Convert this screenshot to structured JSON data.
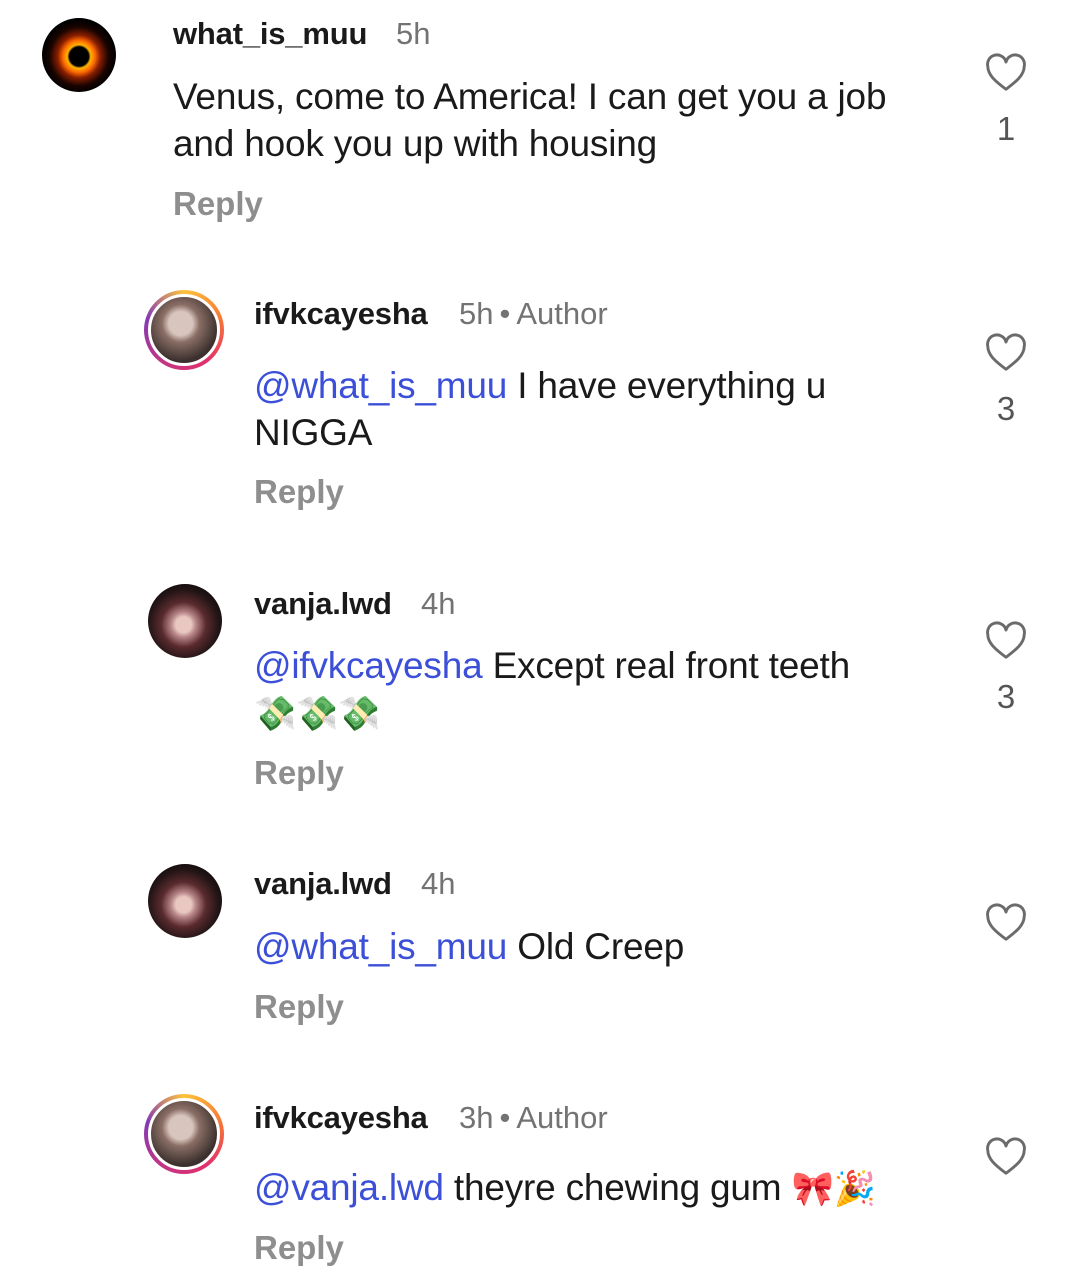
{
  "comments": [
    {
      "username": "what_is_muu",
      "time": "5h",
      "author_label": "",
      "mention": "",
      "text": "Venus, come to America! I can get you a job and hook you up with housing",
      "emoji": "",
      "reply": "Reply",
      "likes": "1"
    },
    {
      "username": "ifvkcayesha",
      "time": "5h",
      "author_label": "Author",
      "mention": "@what_is_muu",
      "text": " I have everything u NIGGA",
      "emoji": "",
      "reply": "Reply",
      "likes": "3"
    },
    {
      "username": "vanja.lwd",
      "time": "4h",
      "author_label": "",
      "mention": "@ifvkcayesha",
      "text": " Except real front teeth",
      "emoji": "💸💸💸",
      "reply": "Reply",
      "likes": "3"
    },
    {
      "username": "vanja.lwd",
      "time": "4h",
      "author_label": "",
      "mention": "@what_is_muu",
      "text": " Old Creep",
      "emoji": "",
      "reply": "Reply",
      "likes": ""
    },
    {
      "username": "ifvkcayesha",
      "time": "3h",
      "author_label": "Author",
      "mention": "@vanja.lwd",
      "text": " theyre chewing gum ",
      "emoji": "🎀🎉",
      "reply": "Reply",
      "likes": ""
    }
  ],
  "icons": {
    "like": "heart-outline-icon"
  }
}
